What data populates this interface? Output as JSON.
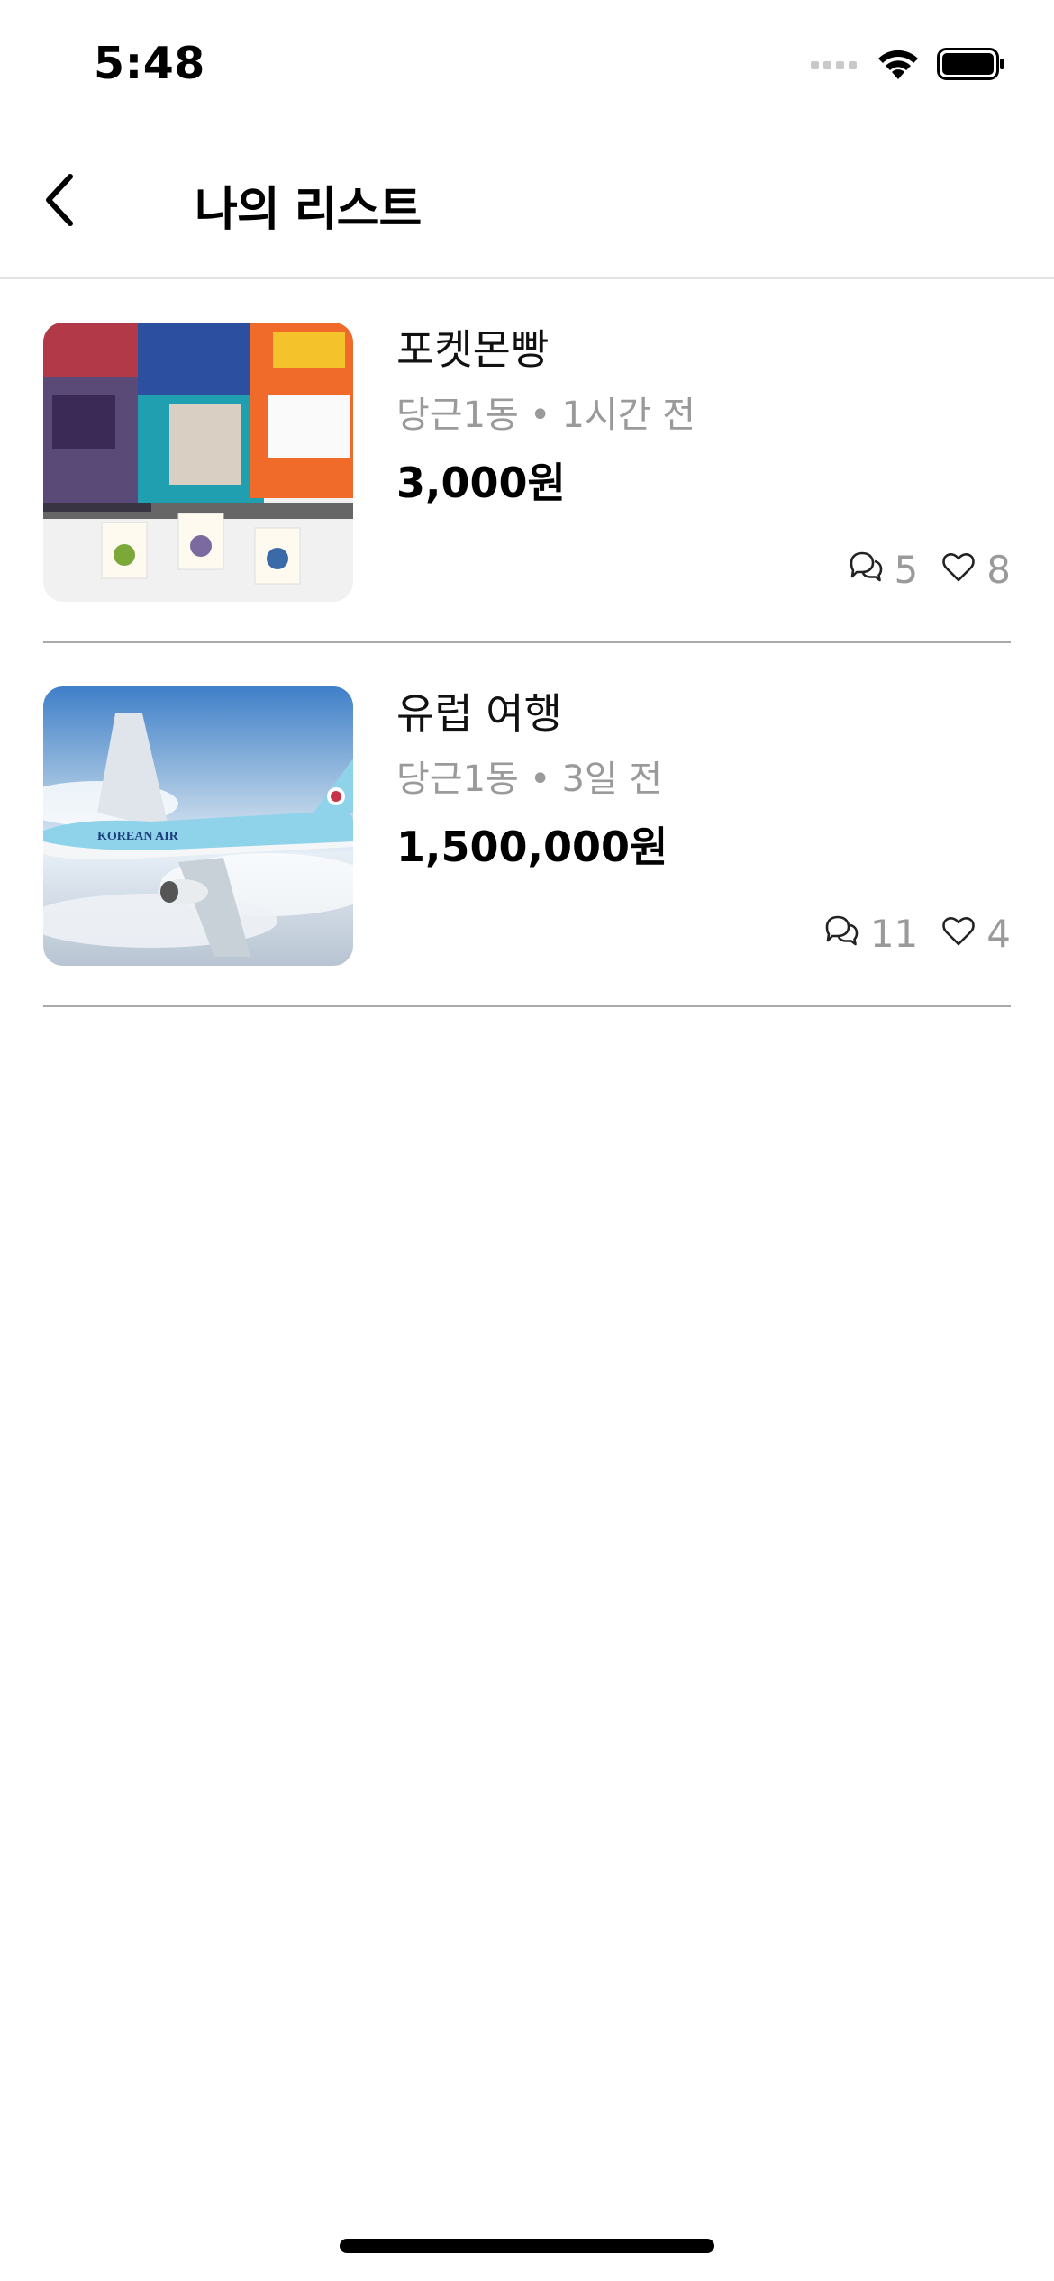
{
  "status_bar": {
    "time": "5:48"
  },
  "header": {
    "title": "나의 리스트",
    "back_icon": "chevron-left-icon"
  },
  "items": [
    {
      "title": "포켓몬빵",
      "location": "당근1동",
      "separator": "•",
      "time_ago": "1시간 전",
      "price": "3,000원",
      "chat_count": "5",
      "like_count": "8"
    },
    {
      "title": "유럽 여행",
      "location": "당근1동",
      "separator": "•",
      "time_ago": "3일 전",
      "price": "1,500,000원",
      "chat_count": "11",
      "like_count": "4"
    }
  ],
  "colors": {
    "meta_text": "#9a9a9a",
    "divider": "#a9a9a9",
    "header_border": "#e3e3e3"
  }
}
